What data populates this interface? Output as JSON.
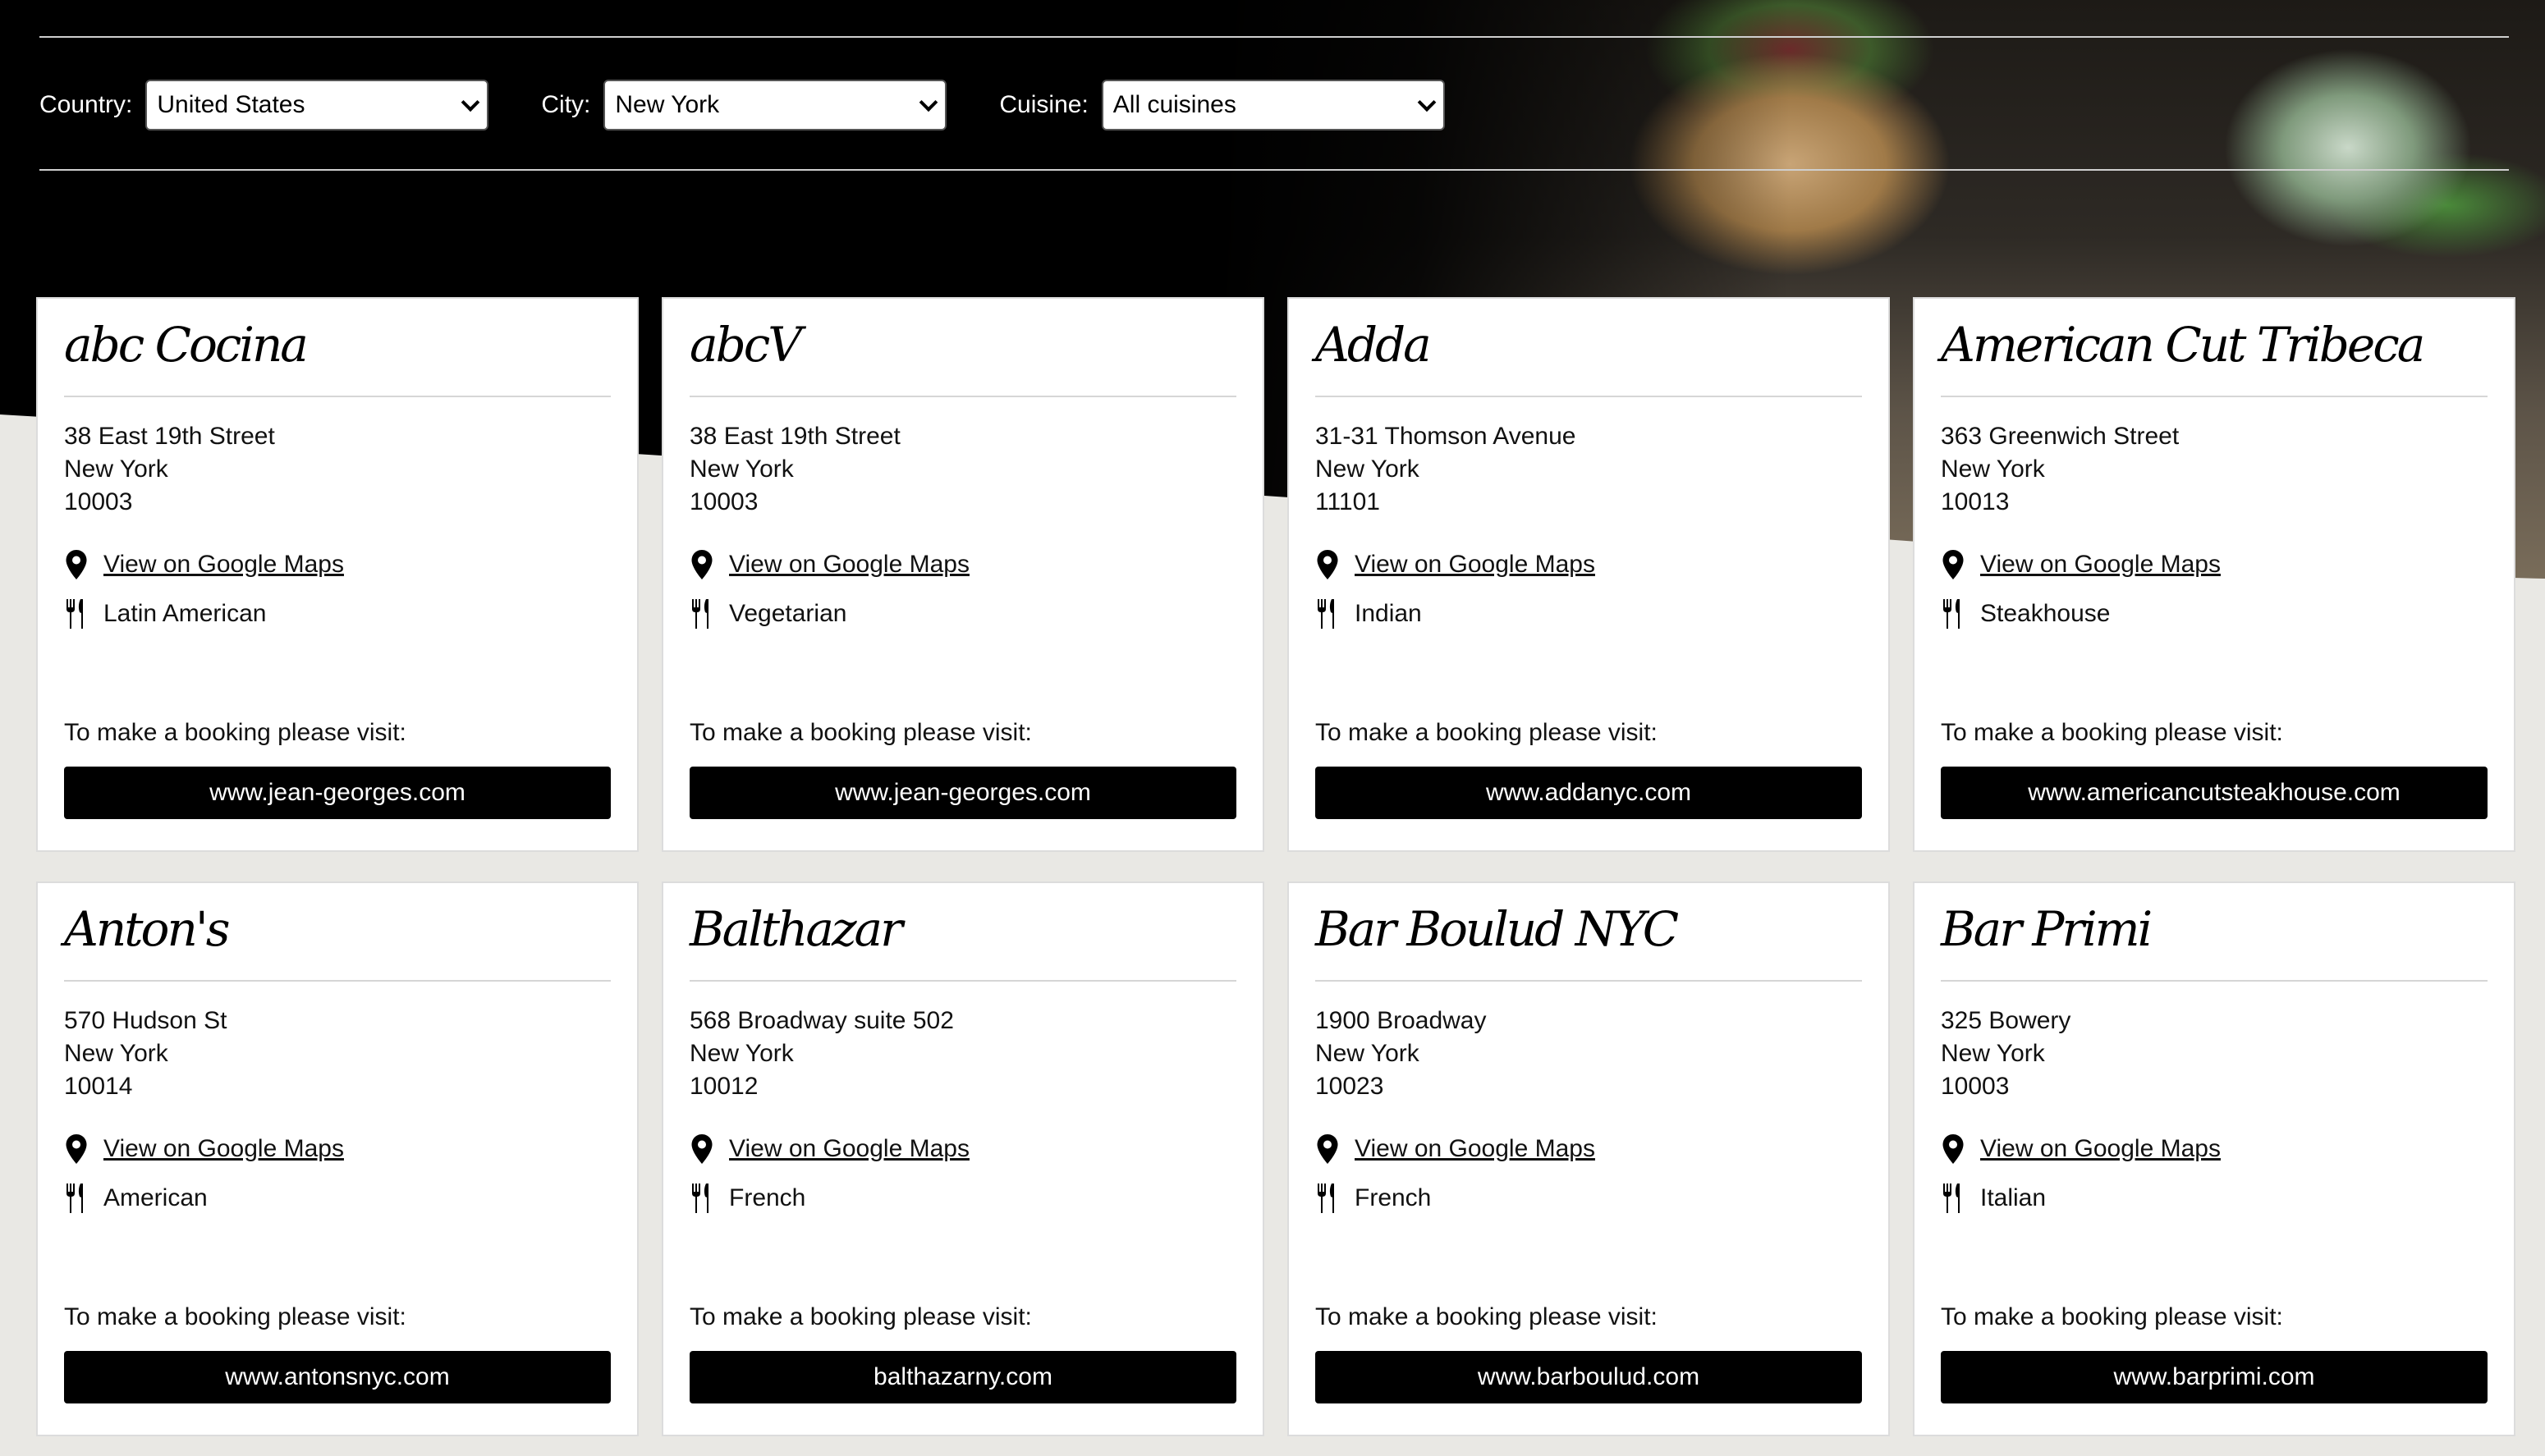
{
  "filters": {
    "country_label": "Country:",
    "country_value": "United States",
    "city_label": "City:",
    "city_value": "New York",
    "cuisine_label": "Cuisine:",
    "cuisine_value": "All cuisines"
  },
  "booking_prompt": "To make a booking please visit:",
  "maps_link_label": "View on Google Maps",
  "icons": {
    "map": "map-pin-icon",
    "cuisine": "fork-knife-icon",
    "dropdown": "chevron-down-icon"
  },
  "restaurants": [
    {
      "name": "abc Cocina",
      "street": "38 East 19th Street",
      "city": "New York",
      "zip": "10003",
      "cuisine": "Latin American",
      "website": "www.jean-georges.com"
    },
    {
      "name": "abcV",
      "street": "38 East 19th Street",
      "city": "New York",
      "zip": "10003",
      "cuisine": "Vegetarian",
      "website": "www.jean-georges.com"
    },
    {
      "name": "Adda",
      "street": "31-31 Thomson Avenue",
      "city": "New York",
      "zip": "11101",
      "cuisine": "Indian",
      "website": "www.addanyc.com"
    },
    {
      "name": "American Cut Tribeca",
      "street": "363 Greenwich Street",
      "city": "New York",
      "zip": "10013",
      "cuisine": "Steakhouse",
      "website": "www.americancutsteakhouse.com"
    },
    {
      "name": "Anton's",
      "street": "570 Hudson St",
      "city": "New York",
      "zip": "10014",
      "cuisine": "American",
      "website": "www.antonsnyc.com"
    },
    {
      "name": "Balthazar",
      "street": "568 Broadway suite 502",
      "city": "New York",
      "zip": "10012",
      "cuisine": "French",
      "website": "balthazarny.com"
    },
    {
      "name": "Bar Boulud NYC",
      "street": "1900 Broadway",
      "city": "New York",
      "zip": "10023",
      "cuisine": "French",
      "website": "www.barboulud.com"
    },
    {
      "name": "Bar Primi",
      "street": "325 Bowery",
      "city": "New York",
      "zip": "10003",
      "cuisine": "Italian",
      "website": "www.barprimi.com"
    }
  ]
}
